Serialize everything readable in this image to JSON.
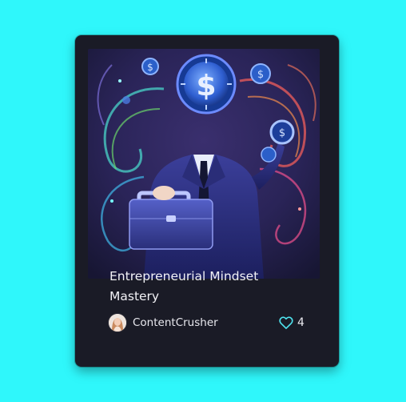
{
  "card": {
    "title": "Entrepreneurial Mindset Mastery",
    "author": {
      "name": "ContentCrusher"
    },
    "likes": {
      "count": "4"
    }
  },
  "colors": {
    "page_background": "#2ff7fb",
    "card_background": "#1a1b26",
    "heart_outline": "#4fe3ee"
  },
  "icons": {
    "like": "heart-outline-icon",
    "thumbnail": "businessman-dollar-clock-illustration"
  }
}
